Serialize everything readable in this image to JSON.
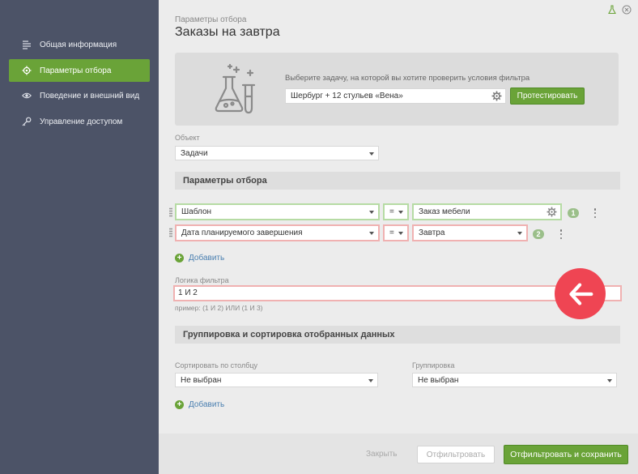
{
  "sidebar": {
    "items": [
      {
        "label": "Общая информация",
        "icon": "list-icon",
        "active": false
      },
      {
        "label": "Параметры отбора",
        "icon": "gear-icon",
        "active": true
      },
      {
        "label": "Поведение и внешний вид",
        "icon": "eye-icon",
        "active": false
      },
      {
        "label": "Управление доступом",
        "icon": "key-icon",
        "active": false
      }
    ]
  },
  "header": {
    "breadcrumb": "Параметры отбора",
    "title": "Заказы на завтра"
  },
  "test_panel": {
    "hint": "Выберите задачу, на которой вы хотите проверить условия фильтра",
    "task_value": "Шербург + 12 стульев «Вена»",
    "test_button": "Протестировать"
  },
  "object": {
    "label": "Объект",
    "value": "Задачи"
  },
  "filter_section": {
    "title": "Параметры отбора",
    "conditions": [
      {
        "field": "Шаблон",
        "operator": "=",
        "value": "Заказ мебели",
        "number": "1"
      },
      {
        "field": "Дата планируемого завершения",
        "operator": "=",
        "value": "Завтра",
        "number": "2"
      }
    ],
    "add_label": "Добавить"
  },
  "logic": {
    "label": "Логика фильтра",
    "value": "1 И 2",
    "example": "пример: (1 И 2) ИЛИ (1 И 3)"
  },
  "grouping_section": {
    "title": "Группировка и сортировка отобранных данных",
    "sort_label": "Сортировать по столбцу",
    "sort_value": "Не выбран",
    "group_label": "Группировка",
    "group_value": "Не выбран",
    "add_label": "Добавить"
  },
  "footer": {
    "close_label": "Закрыть",
    "filter_label": "Отфильтровать",
    "filter_save_label": "Отфильтровать и сохранить"
  },
  "colors": {
    "sidebar_bg": "#4c5367",
    "accent_green": "#6aa338",
    "highlight_red": "#ef4553"
  }
}
